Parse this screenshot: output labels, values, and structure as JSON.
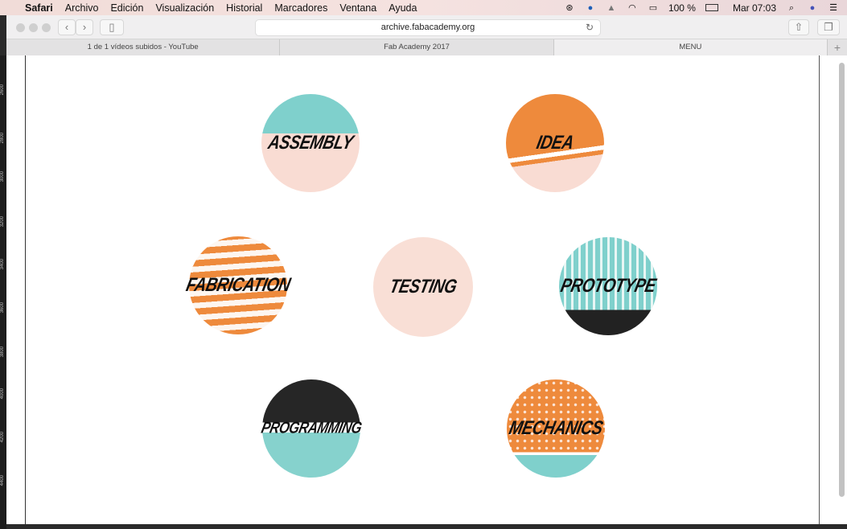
{
  "menubar": {
    "app": "Safari",
    "items": [
      "Archivo",
      "Edición",
      "Visualización",
      "Historial",
      "Marcadores",
      "Ventana",
      "Ayuda"
    ],
    "battery": "100 %",
    "clock": "Mar 07:03"
  },
  "toolbar": {
    "url": "archive.fabacademy.org"
  },
  "tabs": [
    "1 de 1 vídeos subidos - YouTube",
    "Fab Academy 2017",
    "MENU"
  ],
  "ruler": [
    "2600",
    "2800",
    "3000",
    "3200",
    "3400",
    "3600",
    "3800",
    "4000",
    "4200",
    "4400"
  ],
  "circles": {
    "assembly": "ASSEMBLY",
    "idea": "IDEA",
    "fabrication": "FABRICATION",
    "testing": "TESTING",
    "prototype": "PROTOTYPE",
    "programming": "PROGRAMMING",
    "mechanics": "MECHANICS"
  },
  "colors": {
    "teal": "#7fd0cc",
    "orange": "#ee8a3c",
    "pink": "#f9dcd3",
    "black": "#222222"
  }
}
